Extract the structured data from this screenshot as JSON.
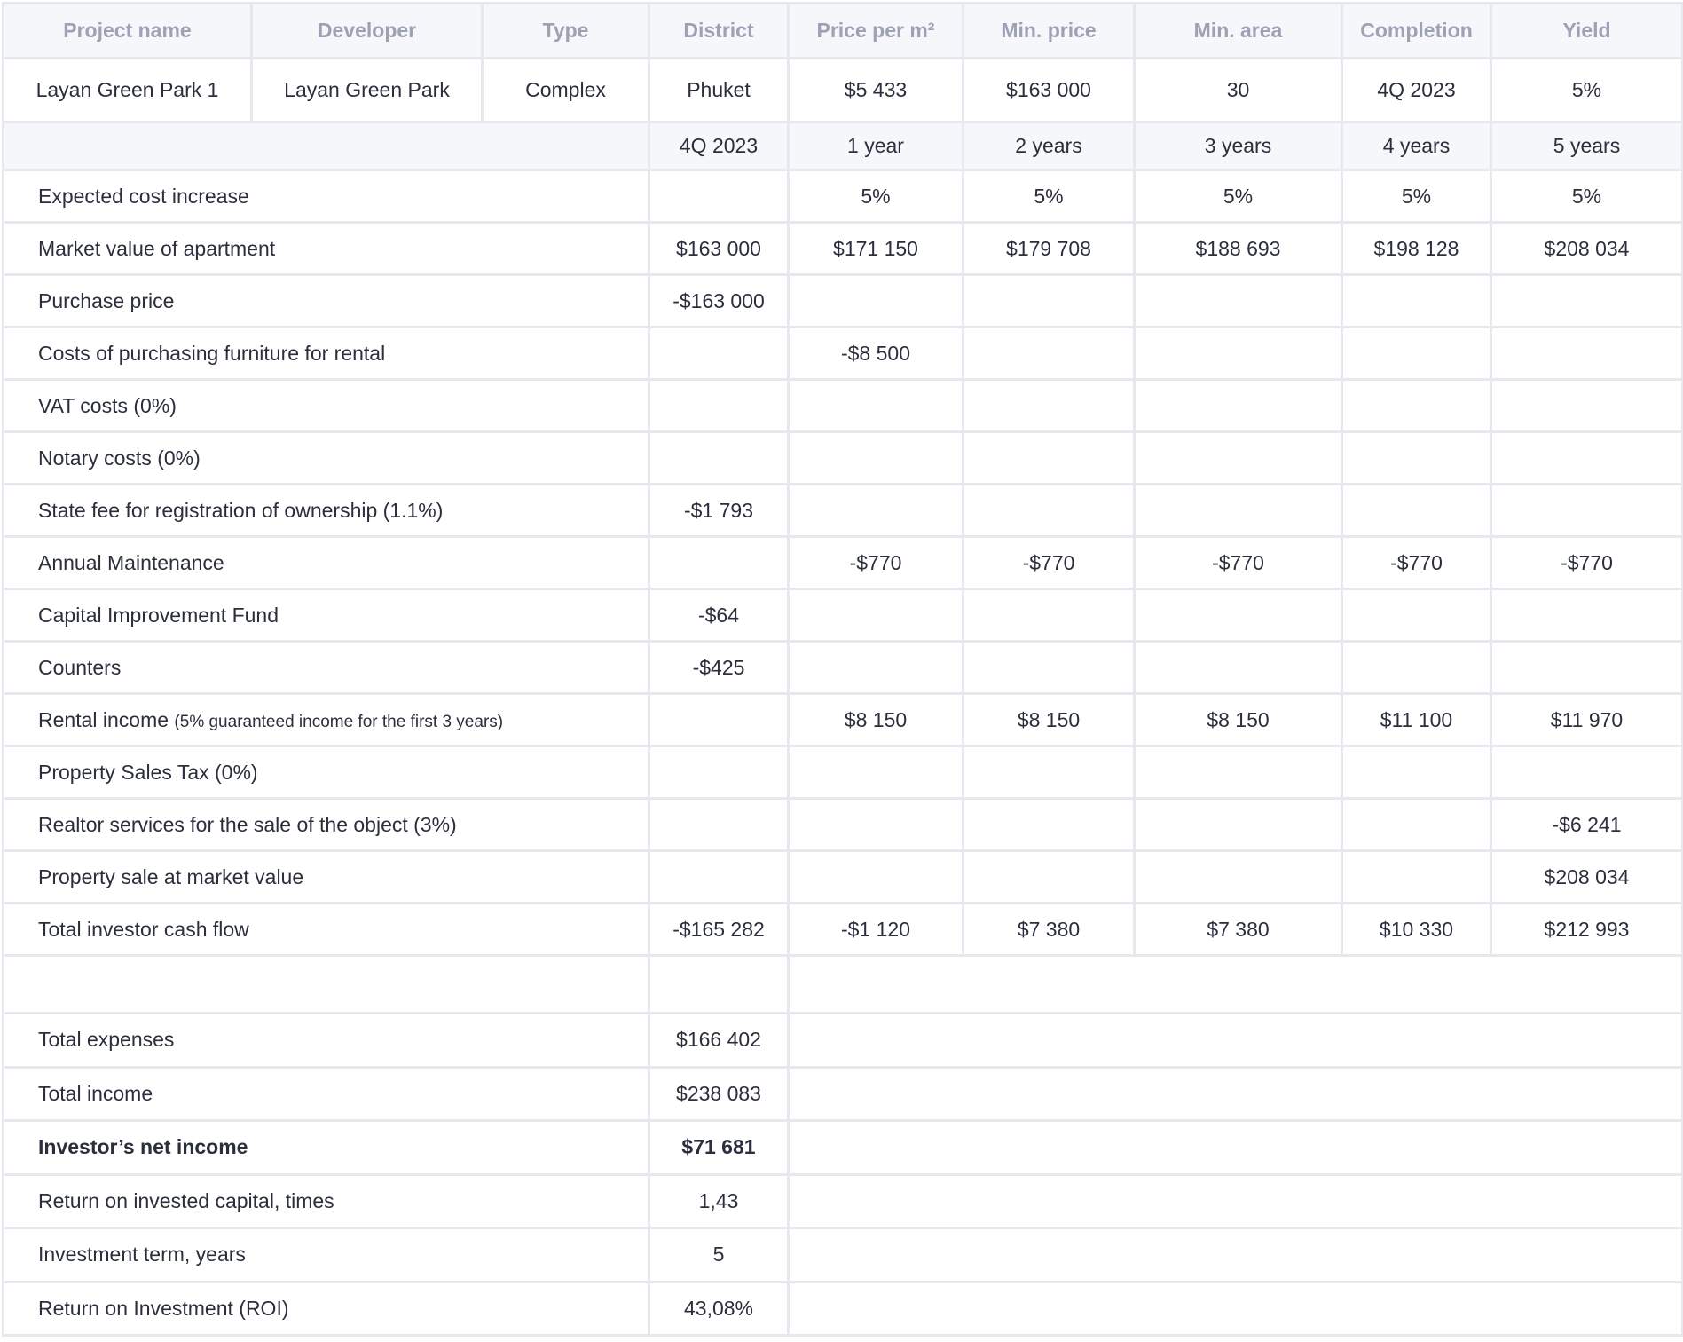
{
  "header": {
    "project_name": "Project name",
    "developer": "Developer",
    "type": "Type",
    "district": "District",
    "price_per_m2": "Price per m²",
    "min_price": "Min. price",
    "min_area": "Min. area",
    "completion": "Completion",
    "yield": "Yield"
  },
  "project": {
    "name": "Layan Green Park 1",
    "developer": "Layan Green Park",
    "type": "Complex",
    "district": "Phuket",
    "price_per_m2": "$5 433",
    "min_price": "$163 000",
    "min_area": "30",
    "completion": "4Q 2023",
    "yield": "5%"
  },
  "years": [
    "4Q 2023",
    "1 year",
    "2 years",
    "3 years",
    "4 years",
    "5 years"
  ],
  "rows": [
    {
      "label": "Expected cost increase",
      "note": "",
      "values": [
        "",
        "5%",
        "5%",
        "5%",
        "5%",
        "5%"
      ]
    },
    {
      "label": "Market value of apartment",
      "note": "",
      "values": [
        "$163 000",
        "$171 150",
        "$179 708",
        "$188 693",
        "$198 128",
        "$208 034"
      ]
    },
    {
      "label": "Purchase price",
      "note": "",
      "values": [
        "-$163 000",
        "",
        "",
        "",
        "",
        ""
      ]
    },
    {
      "label": "Costs of purchasing furniture for rental",
      "note": "",
      "values": [
        "",
        "-$8 500",
        "",
        "",
        "",
        ""
      ]
    },
    {
      "label": "VAT costs (0%)",
      "note": "",
      "values": [
        "",
        "",
        "",
        "",
        "",
        ""
      ]
    },
    {
      "label": "Notary costs (0%)",
      "note": "",
      "values": [
        "",
        "",
        "",
        "",
        "",
        ""
      ]
    },
    {
      "label": "State fee for registration of ownership (1.1%)",
      "note": "",
      "values": [
        "-$1 793",
        "",
        "",
        "",
        "",
        ""
      ]
    },
    {
      "label": "Annual Maintenance",
      "note": "",
      "values": [
        "",
        "-$770",
        "-$770",
        "-$770",
        "-$770",
        "-$770"
      ]
    },
    {
      "label": "Capital Improvement Fund",
      "note": "",
      "values": [
        "-$64",
        "",
        "",
        "",
        "",
        ""
      ]
    },
    {
      "label": "Counters",
      "note": "",
      "values": [
        "-$425",
        "",
        "",
        "",
        "",
        ""
      ]
    },
    {
      "label": "Rental income",
      "note": "(5% guaranteed income for the first 3 years)",
      "values": [
        "",
        "$8 150",
        "$8 150",
        "$8 150",
        "$11 100",
        "$11 970"
      ]
    },
    {
      "label": "Property Sales Tax (0%)",
      "note": "",
      "values": [
        "",
        "",
        "",
        "",
        "",
        ""
      ]
    },
    {
      "label": "Realtor services for the sale of the object (3%)",
      "note": "",
      "values": [
        "",
        "",
        "",
        "",
        "",
        "-$6 241"
      ]
    },
    {
      "label": "Property sale at market value",
      "note": "",
      "values": [
        "",
        "",
        "",
        "",
        "",
        "$208 034"
      ]
    },
    {
      "label": "Total investor cash flow",
      "note": "",
      "values": [
        "-$165 282",
        "-$1 120",
        "$7 380",
        "$7 380",
        "$10 330",
        "$212 993"
      ]
    }
  ],
  "summary": [
    {
      "label": "Total expenses",
      "value": "$166 402",
      "highlight": false
    },
    {
      "label": "Total income",
      "value": "$238 083",
      "highlight": false
    },
    {
      "label": "Investor’s net income",
      "value": "$71 681",
      "highlight": true
    },
    {
      "label": "Return on invested capital, times",
      "value": "1,43",
      "highlight": false
    },
    {
      "label": "Investment term, years",
      "value": "5",
      "highlight": false
    },
    {
      "label": "Return on Investment (ROI)",
      "value": "43,08%",
      "highlight": false
    }
  ],
  "colors": {
    "border": "#e7e8ee",
    "header_bg": "#f6f7fb",
    "header_text": "#9ca1b3",
    "highlight": "#6cb33f"
  }
}
